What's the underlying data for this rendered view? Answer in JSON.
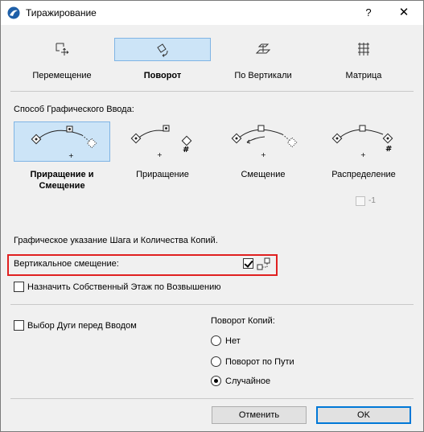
{
  "window": {
    "title": "Тиражирование",
    "help_label": "?",
    "close_label": "✕"
  },
  "tabs": [
    {
      "label": "Перемещение",
      "icon": "move-icon",
      "selected": false
    },
    {
      "label": "Поворот",
      "icon": "rotate-icon",
      "selected": true
    },
    {
      "label": "По Вертикали",
      "icon": "elevate-icon",
      "selected": false
    },
    {
      "label": "Матрица",
      "icon": "matrix-icon",
      "selected": false
    }
  ],
  "input_method": {
    "heading": "Способ Графического Ввода:",
    "options": [
      {
        "label": "Приращение и Смещение",
        "selected": true
      },
      {
        "label": "Приращение",
        "selected": false
      },
      {
        "label": "Смещение",
        "selected": false
      },
      {
        "label": "Распределение",
        "selected": false
      }
    ],
    "minus_one_label": "-1",
    "minus_one_checked": false
  },
  "graphic_hint": "Графическое указание Шага и Количества Копий.",
  "vertical_offset": {
    "label": "Вертикальное смещение:",
    "checked": true
  },
  "assign_story": {
    "label": "Назначить Собственный Этаж по Возвышению",
    "checked": false
  },
  "arc_select": {
    "label": "Выбор Дуги перед Вводом",
    "checked": false
  },
  "rotate_copies": {
    "heading": "Поворот Копий:",
    "options": [
      {
        "label": "Нет",
        "checked": false
      },
      {
        "label": "Поворот по Пути",
        "checked": false
      },
      {
        "label": "Случайное",
        "checked": true
      }
    ]
  },
  "buttons": {
    "cancel": "Отменить",
    "ok": "OK"
  },
  "colors": {
    "selection": "#cce4f7",
    "selection_border": "#7fb4e4",
    "highlight": "#e02020",
    "default_button": "#0078d7"
  }
}
